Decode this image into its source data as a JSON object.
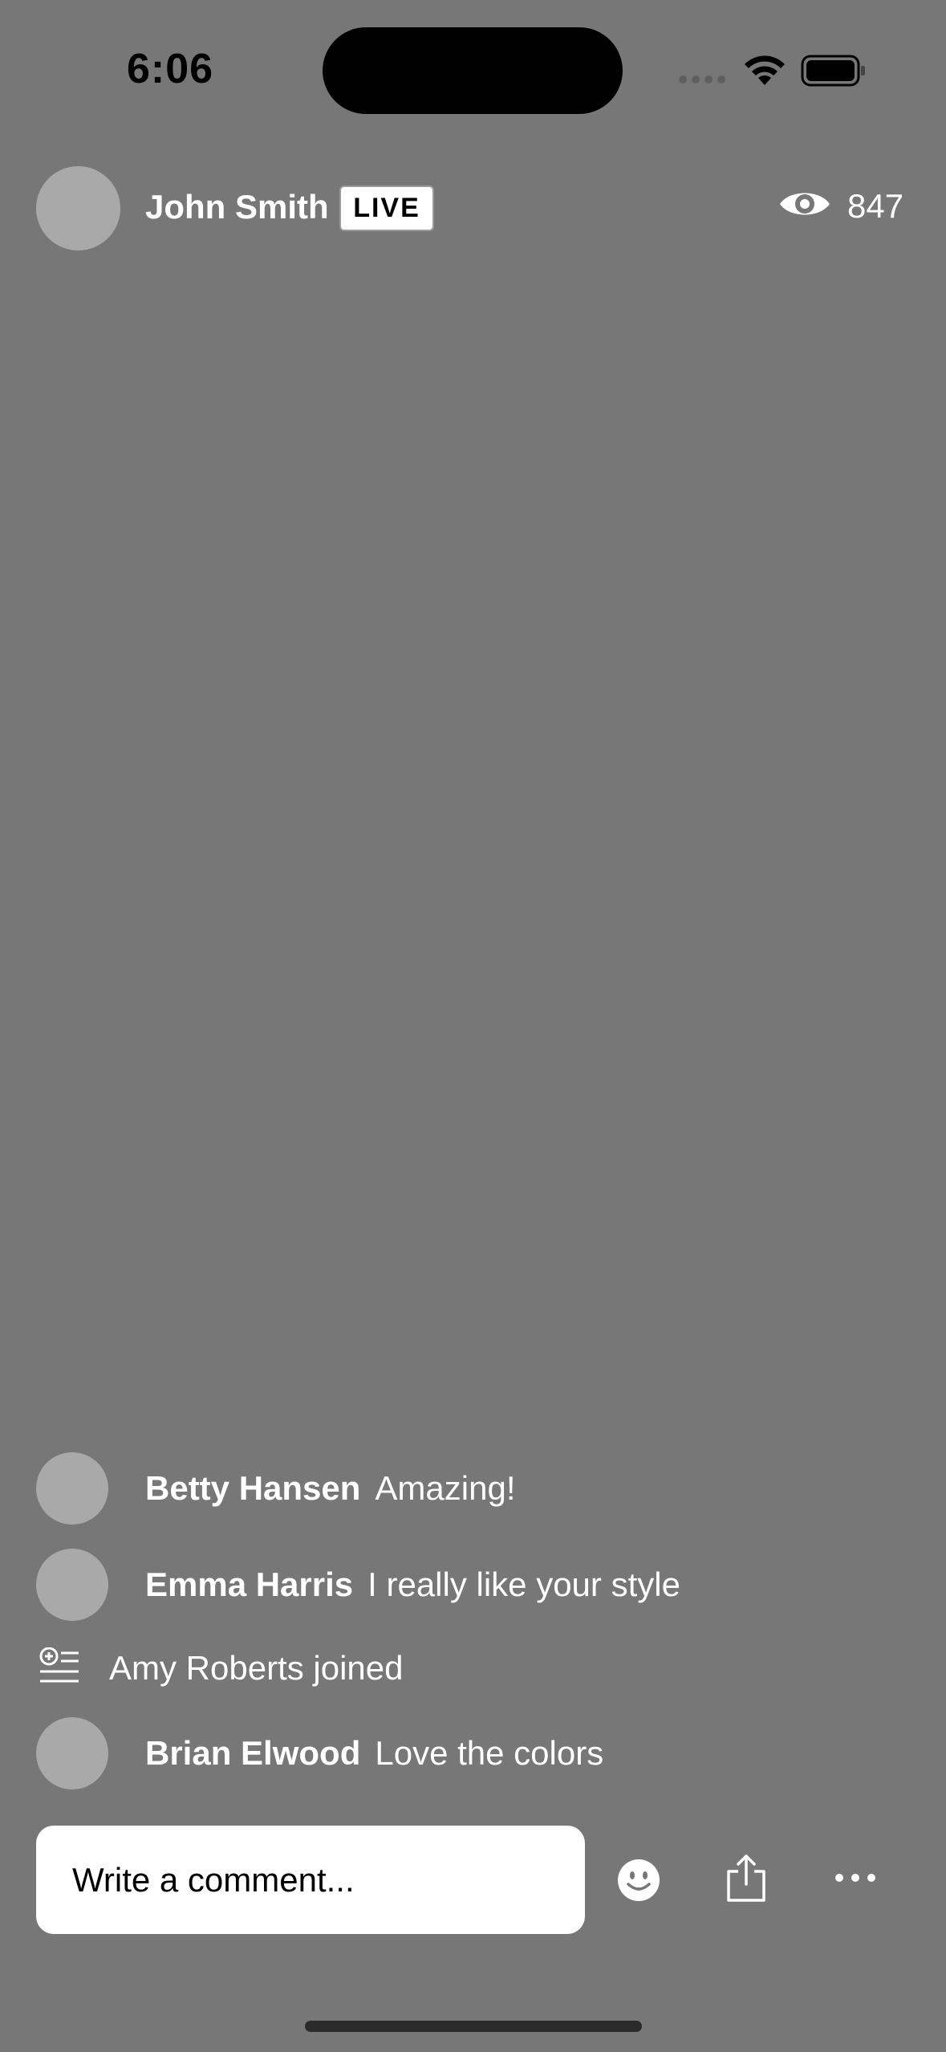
{
  "status_bar": {
    "time": "6:06"
  },
  "stream": {
    "host_name": "John Smith",
    "live_label": "LIVE",
    "viewer_count": "847",
    "viewer_icon": "eye-icon"
  },
  "comments": [
    {
      "author": "Betty Hansen",
      "text": "Amazing!"
    },
    {
      "author": "Emma Harris",
      "text": "I really like your style"
    },
    {
      "author": "Brian Elwood",
      "text": "Love the colors"
    }
  ],
  "join_event": {
    "text": "Amy Roberts joined",
    "icon": "user-joined-icon"
  },
  "composer": {
    "placeholder": "Write a comment..."
  },
  "actions": {
    "emoji_icon": "smiley-icon",
    "share_icon": "share-icon",
    "more_icon": "more-icon"
  },
  "colors": {
    "background": "#777777",
    "avatar": "#a9a9a9",
    "text": "#ffffff"
  }
}
